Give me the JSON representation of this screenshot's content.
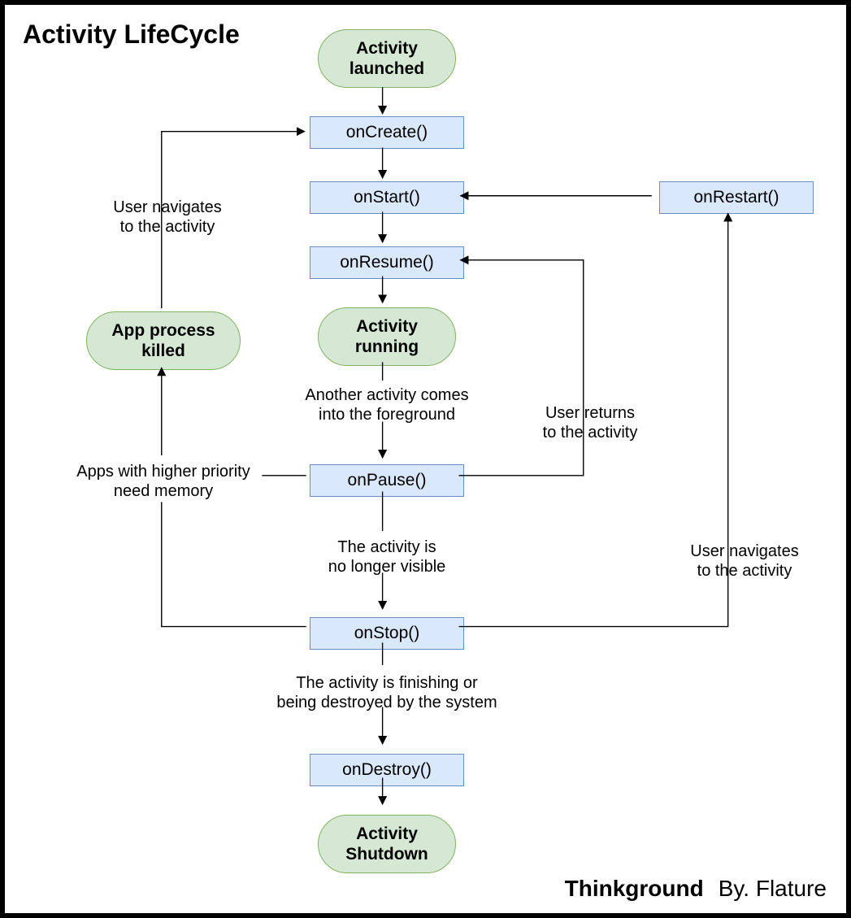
{
  "title": "Activity LifeCycle",
  "footer": {
    "brand": "Thinkground",
    "by": "By. Flature"
  },
  "nodes": {
    "launched": {
      "label": "Activity\nlaunched"
    },
    "onCreate": {
      "label": "onCreate()"
    },
    "onStart": {
      "label": "onStart()"
    },
    "onResume": {
      "label": "onResume()"
    },
    "running": {
      "label": "Activity\nrunning"
    },
    "onPause": {
      "label": "onPause()"
    },
    "onStop": {
      "label": "onStop()"
    },
    "onDestroy": {
      "label": "onDestroy()"
    },
    "shutdown": {
      "label": "Activity\nShutdown"
    },
    "onRestart": {
      "label": "onRestart()"
    },
    "appKilled": {
      "label": "App process\nkilled"
    }
  },
  "edgeLabels": {
    "foreground": "Another activity comes\ninto the foreground",
    "noLongerVis": "The activity is\nno longer visible",
    "finishing": "The activity is finishing or\nbeing destroyed by the system",
    "userReturns": "User returns\nto the activity",
    "navToAct1": "User navigates\nto the activity",
    "navToAct2": "User navigates\nto the activity",
    "higherPrio": "Apps with higher priority\nneed memory"
  }
}
